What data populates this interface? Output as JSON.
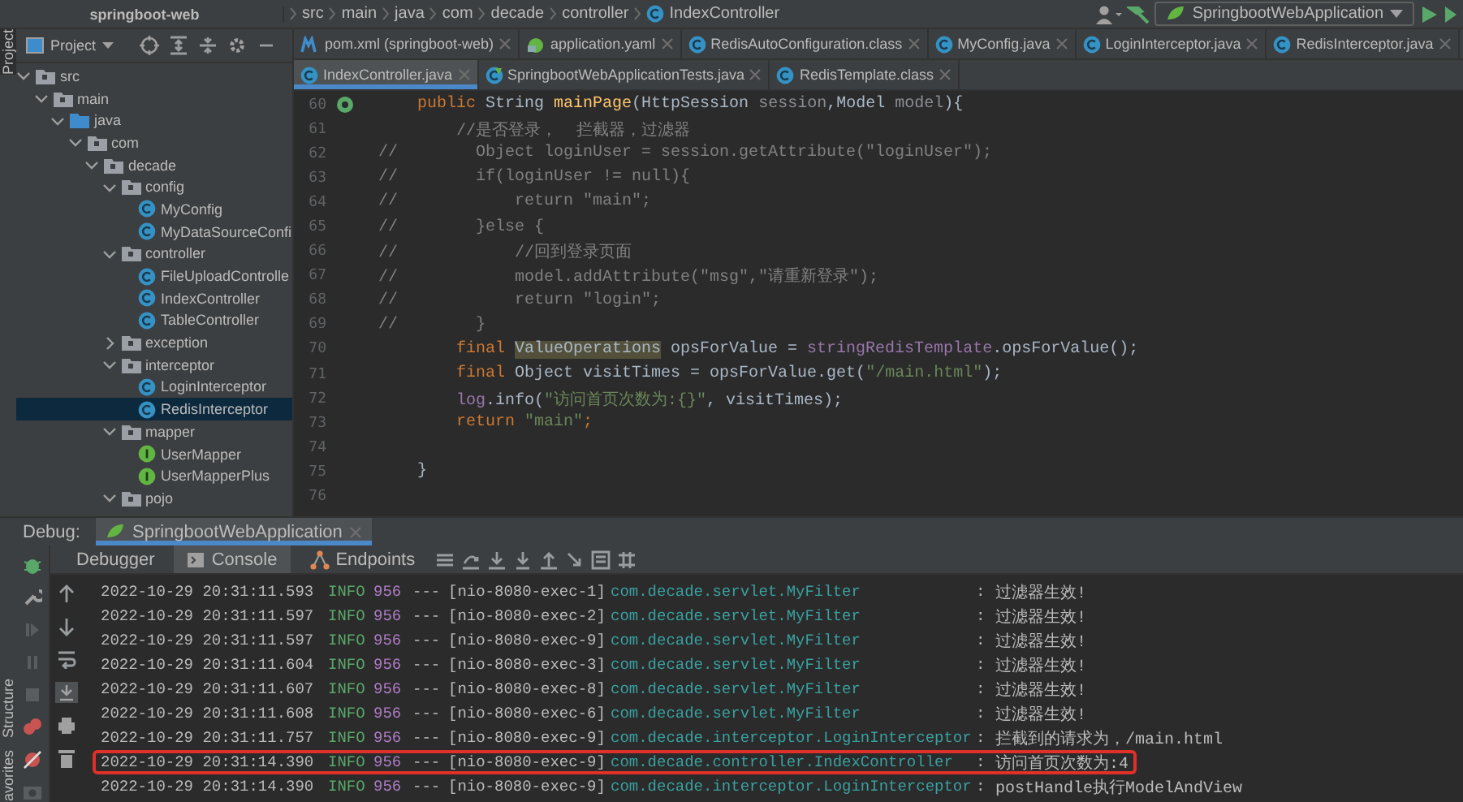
{
  "breadcrumb": [
    {
      "label": "springboot-web",
      "kind": "project"
    },
    {
      "label": "src",
      "kind": "folder"
    },
    {
      "label": "main",
      "kind": "folder"
    },
    {
      "label": "java",
      "kind": "folder"
    },
    {
      "label": "com",
      "kind": "folder"
    },
    {
      "label": "decade",
      "kind": "folder"
    },
    {
      "label": "controller",
      "kind": "folder"
    },
    {
      "label": "IndexController",
      "kind": "class"
    }
  ],
  "toolbar": {
    "run_configuration": "SpringbootWebApplication"
  },
  "side_labels": {
    "project": "Project",
    "structure": "Structure",
    "favorites": "avorites"
  },
  "project_panel": {
    "title": "Project",
    "tree": [
      {
        "label": "src",
        "kind": "folder",
        "expanded": true,
        "selected": false,
        "children": [
          {
            "label": "main",
            "kind": "folder",
            "expanded": true,
            "selected": false,
            "children": [
              {
                "label": "java",
                "kind": "source",
                "expanded": true,
                "selected": false,
                "children": [
                  {
                    "label": "com",
                    "kind": "folder",
                    "expanded": true,
                    "selected": false,
                    "children": [
                      {
                        "label": "decade",
                        "kind": "folder",
                        "expanded": true,
                        "selected": false,
                        "children": [
                          {
                            "label": "config",
                            "kind": "folder",
                            "expanded": true,
                            "selected": false,
                            "children": [
                              {
                                "label": "MyConfig",
                                "kind": "class",
                                "selected": false
                              },
                              {
                                "label": "MyDataSourceConfi",
                                "kind": "class",
                                "selected": false
                              }
                            ]
                          },
                          {
                            "label": "controller",
                            "kind": "folder",
                            "expanded": true,
                            "selected": false,
                            "children": [
                              {
                                "label": "FileUploadControlle",
                                "kind": "class",
                                "selected": false
                              },
                              {
                                "label": "IndexController",
                                "kind": "class",
                                "selected": false
                              },
                              {
                                "label": "TableController",
                                "kind": "class",
                                "selected": false
                              }
                            ]
                          },
                          {
                            "label": "exception",
                            "kind": "folder",
                            "expanded": false,
                            "selected": false
                          },
                          {
                            "label": "interceptor",
                            "kind": "folder",
                            "expanded": true,
                            "selected": false,
                            "children": [
                              {
                                "label": "LoginInterceptor",
                                "kind": "class",
                                "selected": false
                              },
                              {
                                "label": "RedisInterceptor",
                                "kind": "class",
                                "selected": true
                              }
                            ]
                          },
                          {
                            "label": "mapper",
                            "kind": "folder",
                            "expanded": true,
                            "selected": false,
                            "children": [
                              {
                                "label": "UserMapper",
                                "kind": "interface",
                                "selected": false
                              },
                              {
                                "label": "UserMapperPlus",
                                "kind": "interface",
                                "selected": false
                              }
                            ]
                          },
                          {
                            "label": "pojo",
                            "kind": "folder",
                            "expanded": true,
                            "selected": false
                          }
                        ]
                      }
                    ]
                  }
                ]
              }
            ]
          }
        ]
      }
    ]
  },
  "editor_tab_rows": [
    [
      {
        "label": "pom.xml (springboot-web)",
        "kind": "maven",
        "selected": false
      },
      {
        "label": "application.yaml",
        "kind": "yaml",
        "selected": false
      },
      {
        "label": "RedisAutoConfiguration.class",
        "kind": "class",
        "selected": false
      },
      {
        "label": "MyConfig.java",
        "kind": "class",
        "selected": false
      },
      {
        "label": "LoginInterceptor.java",
        "kind": "class",
        "selected": false
      },
      {
        "label": "RedisInterceptor.java",
        "kind": "class",
        "selected": false
      }
    ],
    [
      {
        "label": "IndexController.java",
        "kind": "class",
        "selected": true
      },
      {
        "label": "SpringbootWebApplicationTests.java",
        "kind": "test",
        "selected": false
      },
      {
        "label": "RedisTemplate.class",
        "kind": "class",
        "selected": false
      }
    ]
  ],
  "editor": {
    "lines": [
      {
        "number": "60",
        "bean_marker": true,
        "tokens": [
          {
            "kind": "keyword",
            "text": "    public "
          },
          {
            "kind": "plain",
            "text": "String "
          },
          {
            "kind": "method",
            "text": "mainPage"
          },
          {
            "kind": "plain",
            "text": "(HttpSession "
          },
          {
            "kind": "param",
            "text": "session"
          },
          {
            "kind": "plain",
            "text": ",Model "
          },
          {
            "kind": "param",
            "text": "model"
          },
          {
            "kind": "plain",
            "text": "){"
          }
        ]
      },
      {
        "number": "61",
        "tokens": [
          {
            "kind": "comment",
            "text": "        //是否登录，  拦截器，过滤器"
          }
        ]
      },
      {
        "number": "62",
        "tokens": [
          {
            "kind": "comment",
            "text": "//        Object loginUser = session.getAttribute(\"loginUser\");"
          }
        ]
      },
      {
        "number": "63",
        "tokens": [
          {
            "kind": "comment",
            "text": "//        if(loginUser != null){"
          }
        ]
      },
      {
        "number": "64",
        "tokens": [
          {
            "kind": "comment",
            "text": "//            return \"main\";"
          }
        ]
      },
      {
        "number": "65",
        "tokens": [
          {
            "kind": "comment",
            "text": "//        }else {"
          }
        ]
      },
      {
        "number": "66",
        "tokens": [
          {
            "kind": "comment",
            "text": "//            //回到登录页面"
          }
        ]
      },
      {
        "number": "67",
        "tokens": [
          {
            "kind": "comment",
            "text": "//            model.addAttribute(\"msg\",\"请重新登录\");"
          }
        ]
      },
      {
        "number": "68",
        "tokens": [
          {
            "kind": "comment",
            "text": "//            return \"login\";"
          }
        ]
      },
      {
        "number": "69",
        "tokens": [
          {
            "kind": "comment",
            "text": "//        }"
          }
        ]
      },
      {
        "number": "70",
        "tokens": [
          {
            "kind": "keyword",
            "text": "        final "
          },
          {
            "kind": "highlight",
            "text": "ValueOperations"
          },
          {
            "kind": "plain",
            "text": " opsForValue = "
          },
          {
            "kind": "field",
            "text": "stringRedisTemplate"
          },
          {
            "kind": "plain",
            "text": ".opsForValue();"
          }
        ]
      },
      {
        "number": "71",
        "tokens": [
          {
            "kind": "keyword",
            "text": "        final "
          },
          {
            "kind": "plain",
            "text": "Object visitTimes = opsForValue.get("
          },
          {
            "kind": "string",
            "text": "\"/main.html\""
          },
          {
            "kind": "plain",
            "text": ");"
          }
        ]
      },
      {
        "number": "72",
        "tokens": [
          {
            "kind": "field",
            "text": "        log"
          },
          {
            "kind": "plain",
            "text": ".info("
          },
          {
            "kind": "string",
            "text": "\"访问首页次数为:{}\""
          },
          {
            "kind": "plain",
            "text": ", visitTimes);"
          }
        ]
      },
      {
        "number": "73",
        "tokens": [
          {
            "kind": "keyword",
            "text": "        return "
          },
          {
            "kind": "string",
            "text": "\"main\""
          },
          {
            "kind": "keyword",
            "text": ";"
          }
        ]
      },
      {
        "number": "74"
      },
      {
        "number": "75",
        "tokens": [
          {
            "kind": "plain",
            "text": "    }"
          }
        ]
      },
      {
        "number": "76"
      }
    ]
  },
  "debug": {
    "label": "Debug:",
    "session_tab": "SpringbootWebApplication",
    "tabs": [
      {
        "label": "Debugger",
        "kind": "debugger",
        "selected": false
      },
      {
        "label": "Console",
        "kind": "console",
        "selected": true
      },
      {
        "label": "Endpoints",
        "kind": "endpoints",
        "selected": false
      }
    ],
    "console_lines": [
      {
        "time": "2022-10-29 20:31:11.593",
        "level": "INFO",
        "pid": "956",
        "separator": "---",
        "thread": "[nio-8080-exec-1]",
        "logger": "com.decade.servlet.MyFilter",
        "colon": ":",
        "message": "过滤器生效!",
        "highlighted": false
      },
      {
        "time": "2022-10-29 20:31:11.597",
        "level": "INFO",
        "pid": "956",
        "separator": "---",
        "thread": "[nio-8080-exec-2]",
        "logger": "com.decade.servlet.MyFilter",
        "colon": ":",
        "message": "过滤器生效!",
        "highlighted": false
      },
      {
        "time": "2022-10-29 20:31:11.597",
        "level": "INFO",
        "pid": "956",
        "separator": "---",
        "thread": "[nio-8080-exec-9]",
        "logger": "com.decade.servlet.MyFilter",
        "colon": ":",
        "message": "过滤器生效!",
        "highlighted": false
      },
      {
        "time": "2022-10-29 20:31:11.604",
        "level": "INFO",
        "pid": "956",
        "separator": "---",
        "thread": "[nio-8080-exec-3]",
        "logger": "com.decade.servlet.MyFilter",
        "colon": ":",
        "message": "过滤器生效!",
        "highlighted": false
      },
      {
        "time": "2022-10-29 20:31:11.607",
        "level": "INFO",
        "pid": "956",
        "separator": "---",
        "thread": "[nio-8080-exec-8]",
        "logger": "com.decade.servlet.MyFilter",
        "colon": ":",
        "message": "过滤器生效!",
        "highlighted": false
      },
      {
        "time": "2022-10-29 20:31:11.608",
        "level": "INFO",
        "pid": "956",
        "separator": "---",
        "thread": "[nio-8080-exec-6]",
        "logger": "com.decade.servlet.MyFilter",
        "colon": ":",
        "message": "过滤器生效!",
        "highlighted": false
      },
      {
        "time": "2022-10-29 20:31:11.757",
        "level": "INFO",
        "pid": "956",
        "separator": "---",
        "thread": "[nio-8080-exec-9]",
        "logger": "com.decade.interceptor.LoginInterceptor",
        "colon": ":",
        "message": "拦截到的请求为，/main.html",
        "highlighted": false
      },
      {
        "time": "2022-10-29 20:31:14.390",
        "level": "INFO",
        "pid": "956",
        "separator": "---",
        "thread": "[nio-8080-exec-9]",
        "logger": "com.decade.controller.IndexController",
        "colon": ":",
        "message": "访问首页次数为:4",
        "highlighted": true
      },
      {
        "time": "2022-10-29 20:31:14.390",
        "level": "INFO",
        "pid": "956",
        "separator": "---",
        "thread": "[nio-8080-exec-9]",
        "logger": "com.decade.interceptor.LoginInterceptor",
        "colon": ":",
        "message": "postHandle执行ModelAndView",
        "highlighted": false
      }
    ]
  }
}
